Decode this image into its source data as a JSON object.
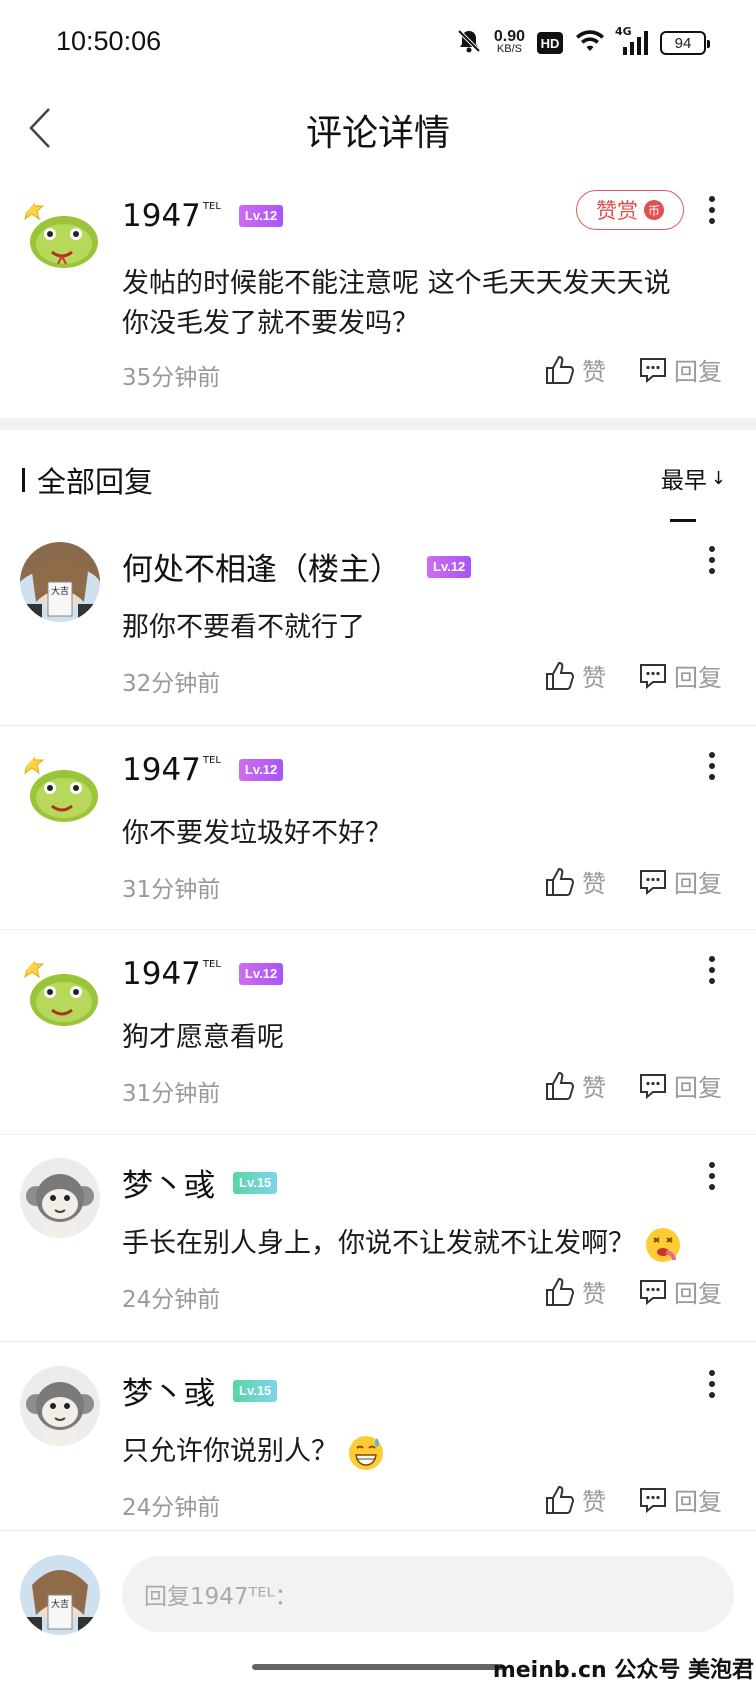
{
  "status_bar": {
    "time": "10:50:06",
    "net_speed_value": "0.90",
    "net_speed_unit": "KB/S",
    "hd_label": "HD",
    "signal_label": "4G",
    "battery": "94"
  },
  "nav": {
    "title": "评论详情"
  },
  "main_comment": {
    "username": "1947",
    "username_sup": "TEL",
    "level": "Lv.12",
    "tip_label": "赞赏",
    "tip_coin": "币",
    "text": "发帖的时候能不能注意呢 这个毛天天发天天说你没毛发了就不要发吗？",
    "time": "35分钟前",
    "like_label": "赞",
    "reply_label": "回复"
  },
  "replies_section": {
    "title": "全部回复",
    "sort_label": "最早",
    "sort_arrow": "↓"
  },
  "replies": [
    {
      "username": "何处不相逢（楼主）",
      "username_sup": "",
      "level": "Lv.12",
      "text": "那你不要看不就行了",
      "time": "32分钟前",
      "like_label": "赞",
      "reply_label": "回复"
    },
    {
      "username": "1947",
      "username_sup": "TEL",
      "level": "Lv.12",
      "text": "你不要发垃圾好不好？",
      "time": "31分钟前",
      "like_label": "赞",
      "reply_label": "回复"
    },
    {
      "username": "1947",
      "username_sup": "TEL",
      "level": "Lv.12",
      "text": "狗才愿意看呢",
      "time": "31分钟前",
      "like_label": "赞",
      "reply_label": "回复"
    },
    {
      "username": "梦丶彧",
      "username_sup": "",
      "level": "Lv.15",
      "text": "手长在别人身上，你说不让发就不让发啊？",
      "time": "24分钟前",
      "like_label": "赞",
      "reply_label": "回复"
    },
    {
      "username": "梦丶彧",
      "username_sup": "",
      "level": "Lv.15",
      "text": "只允许你说别人？",
      "time": "24分钟前",
      "like_label": "赞",
      "reply_label": "回复"
    }
  ],
  "reply_input": {
    "placeholder": "回复1947ᵀᴱᴸ："
  },
  "watermark": "meinb.cn  公众号 美泡君",
  "colors": {
    "level_purple": "#b35cf2",
    "level_green": "#6cd4b8",
    "tip_red": "#e0504f"
  }
}
